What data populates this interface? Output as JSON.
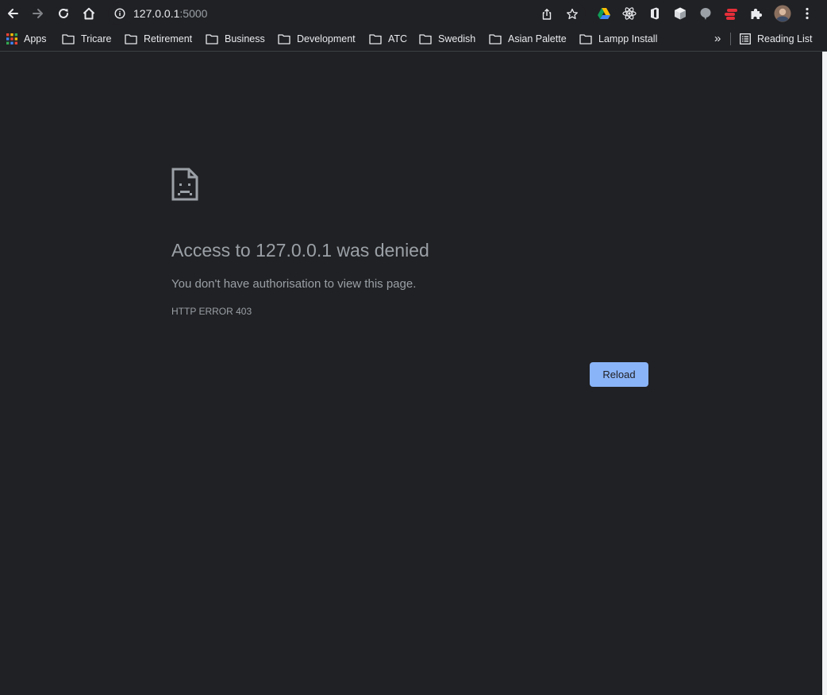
{
  "browser": {
    "url_host": "127.0.0.1",
    "url_port": ":5000",
    "accent": "#8ab4f8"
  },
  "toolbar": {
    "icons": [
      "back-arrow-icon",
      "forward-arrow-icon",
      "reload-icon",
      "home-icon",
      "info-icon",
      "share-icon",
      "bookmark-star-icon",
      "google-drive-icon",
      "react-devtools-icon",
      "office-icon",
      "cube-icon",
      "speech-bubble-icon",
      "red-extension-icon",
      "puzzle-icon",
      "profile-avatar-icon",
      "more-menu-icon"
    ]
  },
  "bookmarks": {
    "items": [
      {
        "label": "Apps",
        "icon": "apps-grid-icon"
      },
      {
        "label": "Tricare",
        "icon": "folder-icon"
      },
      {
        "label": "Retirement",
        "icon": "folder-icon"
      },
      {
        "label": "Business",
        "icon": "folder-icon"
      },
      {
        "label": "Development",
        "icon": "folder-icon"
      },
      {
        "label": "ATC",
        "icon": "folder-icon"
      },
      {
        "label": "Swedish",
        "icon": "folder-icon"
      },
      {
        "label": "Asian Palette",
        "icon": "folder-icon"
      },
      {
        "label": "Lampp Install",
        "icon": "folder-icon"
      }
    ],
    "overflow_label": "»",
    "reading_list_label": "Reading List"
  },
  "error_page": {
    "icon": "sad-document-icon",
    "title": "Access to 127.0.0.1 was denied",
    "description": "You don't have authorisation to view this page.",
    "code": "HTTP ERROR 403",
    "reload_label": "Reload"
  }
}
